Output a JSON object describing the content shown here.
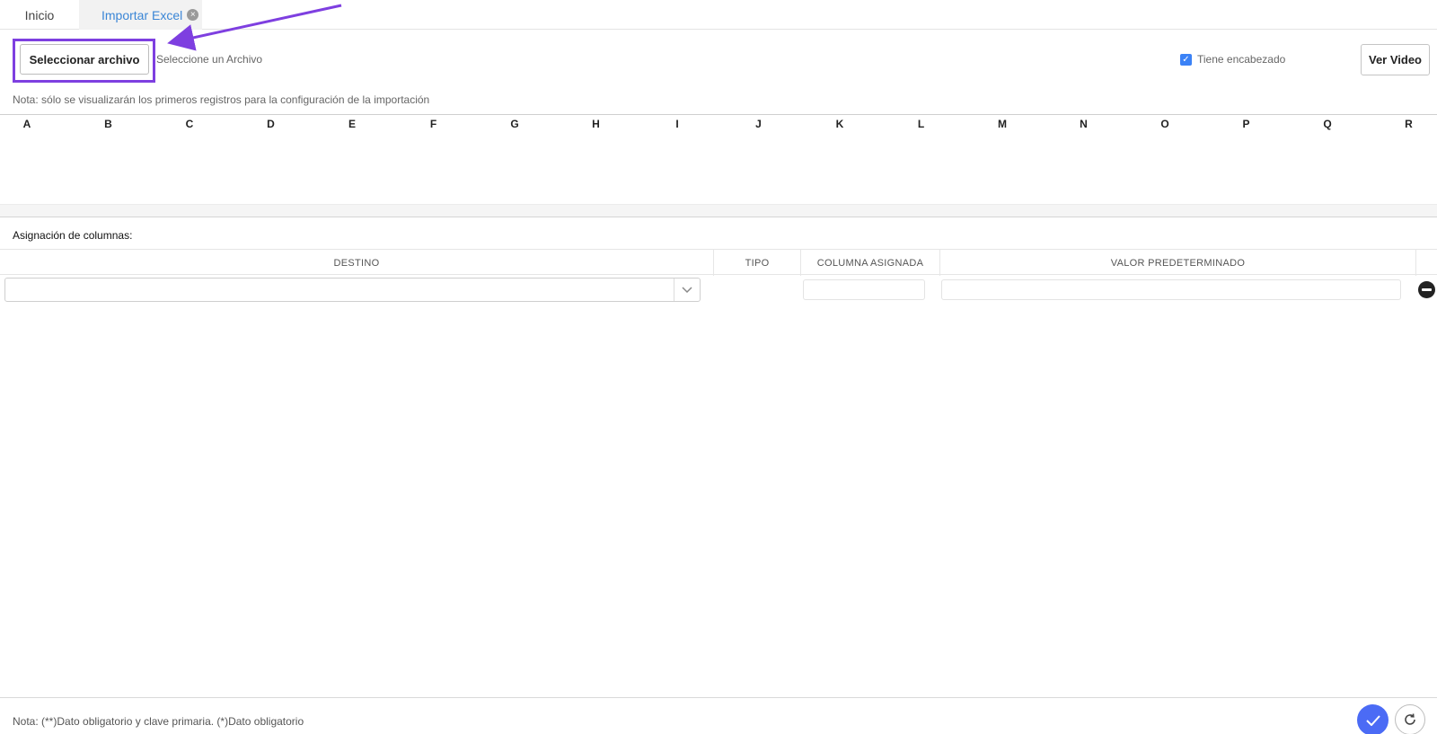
{
  "tabs": {
    "home": "Inicio",
    "import_excel": "Importar Excel",
    "close_glyph": "×"
  },
  "toolbar": {
    "select_file_button": "Seleccionar archivo",
    "file_placeholder": "Seleccione un Archivo",
    "has_header_label": "Tiene encabezado",
    "has_header_checked": true,
    "watch_video_button": "Ver Video"
  },
  "note_top": "Nota: sólo se visualizarán los primeros registros para la configuración de la importación",
  "preview": {
    "columns": [
      "A",
      "B",
      "C",
      "D",
      "E",
      "F",
      "G",
      "H",
      "I",
      "J",
      "K",
      "L",
      "M",
      "N",
      "O",
      "P",
      "Q",
      "R"
    ]
  },
  "assignment": {
    "title": "Asignación de columnas:",
    "headers": {
      "destino": "DESTINO",
      "tipo": "TIPO",
      "columna": "COLUMNA ASIGNADA",
      "valor": "VALOR PREDETERMINADO"
    }
  },
  "footer": {
    "note": "Nota: (**)Dato obligatorio y clave primaria. (*)Dato obligatorio"
  },
  "colors": {
    "accent": "#3b86d6",
    "highlight": "#7e3fe0",
    "confirm": "#4b6bf5"
  }
}
